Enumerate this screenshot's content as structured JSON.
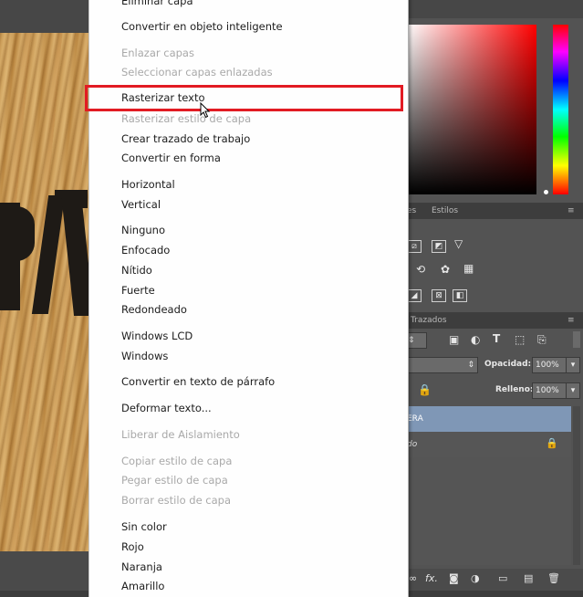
{
  "menu": {
    "items": [
      {
        "label": "Eliminar capa",
        "enabled": true
      },
      {
        "label": "Convertir en objeto inteligente",
        "enabled": true
      },
      {
        "label": "Enlazar capas",
        "enabled": false
      },
      {
        "label": "Seleccionar capas enlazadas",
        "enabled": false
      },
      {
        "label": "Rasterizar texto",
        "enabled": true,
        "highlighted": true
      },
      {
        "label": "Rasterizar estilo de capa",
        "enabled": false
      },
      {
        "label": "Crear trazado de trabajo",
        "enabled": true
      },
      {
        "label": "Convertir en forma",
        "enabled": true
      },
      {
        "label": "Horizontal",
        "enabled": true
      },
      {
        "label": "Vertical",
        "enabled": true
      },
      {
        "label": "Ninguno",
        "enabled": true
      },
      {
        "label": "Enfocado",
        "enabled": true
      },
      {
        "label": "Nítido",
        "enabled": true
      },
      {
        "label": "Fuerte",
        "enabled": true
      },
      {
        "label": "Redondeado",
        "enabled": true
      },
      {
        "label": "Windows LCD",
        "enabled": true
      },
      {
        "label": "Windows",
        "enabled": true
      },
      {
        "label": "Convertir en texto de párrafo",
        "enabled": true
      },
      {
        "label": "Deformar texto...",
        "enabled": true
      },
      {
        "label": "Liberar de Aislamiento",
        "enabled": false
      },
      {
        "label": "Copiar estilo de capa",
        "enabled": false
      },
      {
        "label": "Pegar estilo de capa",
        "enabled": false
      },
      {
        "label": "Borrar estilo de capa",
        "enabled": false
      },
      {
        "label": "Sin color",
        "enabled": true
      },
      {
        "label": "Rojo",
        "enabled": true
      },
      {
        "label": "Naranja",
        "enabled": true
      },
      {
        "label": "Amarillo",
        "enabled": true
      }
    ]
  },
  "panels": {
    "adjustments_tab_fragment": "es",
    "styles_tab": "Estilos",
    "paths_tab": "Trazados",
    "opacity_label": "Opacidad:",
    "opacity_value": "100%",
    "fill_label": "Relleno:",
    "fill_value": "100%",
    "selected_layer_name_fragment": "ERA",
    "layer2_name_fragment": "do"
  },
  "colors": {
    "highlight_border": "#e21b23",
    "selected_layer": "#7f97b6",
    "panel_bg": "#535353"
  }
}
